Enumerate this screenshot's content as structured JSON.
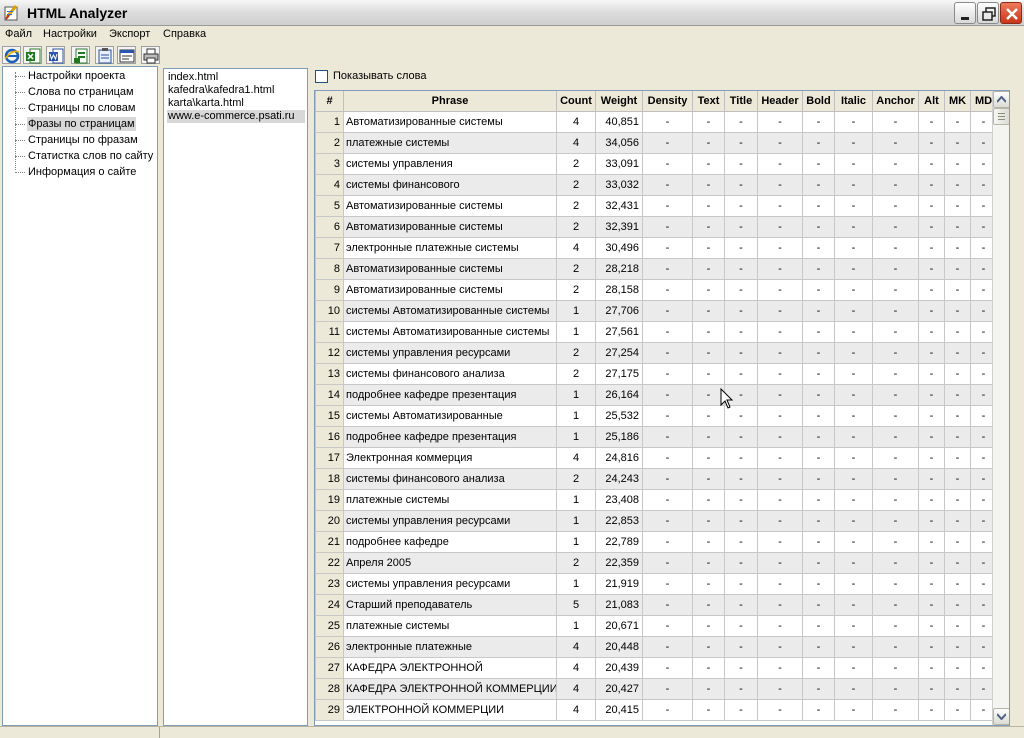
{
  "window": {
    "title": "HTML Analyzer"
  },
  "menu": [
    "Файл",
    "Настройки",
    "Экспорт",
    "Справка"
  ],
  "toolbar": {
    "icons": [
      "ie-icon",
      "excel-icon",
      "word-icon",
      "excel-export-icon",
      "clipboard-icon",
      "report-icon",
      "print-icon"
    ]
  },
  "tree": {
    "items": [
      "Настройки проекта",
      "Слова по страницам",
      "Страницы по словам",
      "Фразы по страницам",
      "Страницы по фразам",
      "Статистка слов по сайту",
      "Информация о сайте"
    ],
    "selected_index": 3
  },
  "files": {
    "items": [
      "index.html",
      "kafedra\\kafedra1.html",
      "karta\\karta.html",
      "www.e-commerce.psati.ru"
    ],
    "selected_index": 3
  },
  "options": {
    "show_words_label": "Показывать слова",
    "show_words_checked": false
  },
  "grid": {
    "columns": [
      "#",
      "Phrase",
      "Count",
      "Weight",
      "Density",
      "Text",
      "Title",
      "Header",
      "Bold",
      "Italic",
      "Anchor",
      "Alt",
      "MK",
      "MD"
    ],
    "empty_value": "-",
    "rows": [
      [
        "1",
        "Автоматизированные системы",
        "4",
        "40,851"
      ],
      [
        "2",
        "платежные системы",
        "4",
        "34,056"
      ],
      [
        "3",
        "системы управления",
        "2",
        "33,091"
      ],
      [
        "4",
        "системы финансового",
        "2",
        "33,032"
      ],
      [
        "5",
        "Автоматизированные системы",
        "2",
        "32,431"
      ],
      [
        "6",
        "Автоматизированные системы",
        "2",
        "32,391"
      ],
      [
        "7",
        "электронные платежные системы",
        "4",
        "30,496"
      ],
      [
        "8",
        "Автоматизированные системы",
        "2",
        "28,218"
      ],
      [
        "9",
        "Автоматизированные системы",
        "2",
        "28,158"
      ],
      [
        "10",
        "системы Автоматизированные системы",
        "1",
        "27,706"
      ],
      [
        "11",
        "системы Автоматизированные системы",
        "1",
        "27,561"
      ],
      [
        "12",
        "системы управления ресурсами",
        "2",
        "27,254"
      ],
      [
        "13",
        "системы финансового анализа",
        "2",
        "27,175"
      ],
      [
        "14",
        "подробнее кафедре презентация",
        "1",
        "26,164"
      ],
      [
        "15",
        "системы Автоматизированные",
        "1",
        "25,532"
      ],
      [
        "16",
        "подробнее кафедре презентация",
        "1",
        "25,186"
      ],
      [
        "17",
        "Электронная коммерция",
        "4",
        "24,816"
      ],
      [
        "18",
        "системы финансового анализа",
        "2",
        "24,243"
      ],
      [
        "19",
        "платежные системы",
        "1",
        "23,408"
      ],
      [
        "20",
        "системы управления ресурсами",
        "1",
        "22,853"
      ],
      [
        "21",
        "подробнее кафедре",
        "1",
        "22,789"
      ],
      [
        "22",
        "Апреля 2005",
        "2",
        "22,359"
      ],
      [
        "23",
        "системы управления ресурсами",
        "1",
        "21,919"
      ],
      [
        "24",
        "Старший преподаватель",
        "5",
        "21,083"
      ],
      [
        "25",
        "платежные системы",
        "1",
        "20,671"
      ],
      [
        "26",
        "электронные платежные",
        "4",
        "20,448"
      ],
      [
        "27",
        "КАФЕДРА ЭЛЕКТРОННОЙ",
        "4",
        "20,439"
      ],
      [
        "28",
        "КАФЕДРА ЭЛЕКТРОННОЙ КОММЕРЦИИ",
        "4",
        "20,427"
      ],
      [
        "29",
        "ЭЛЕКТРОННОЙ КОММЕРЦИИ",
        "4",
        "20,415"
      ]
    ]
  }
}
